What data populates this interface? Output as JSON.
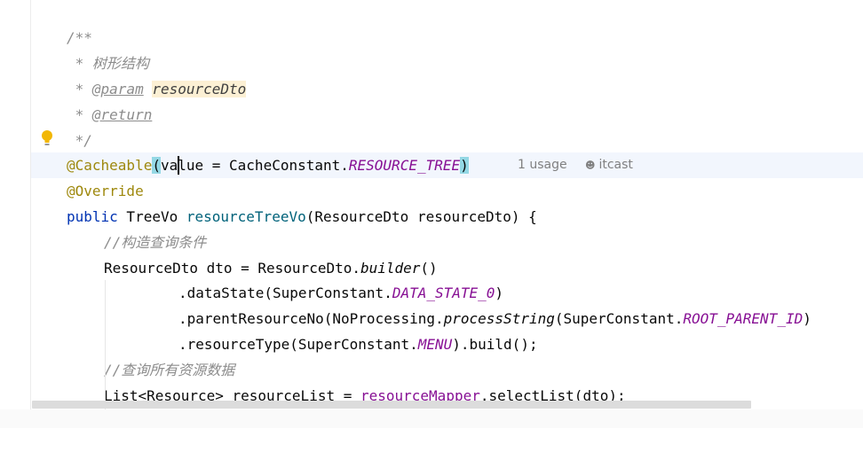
{
  "editor": {
    "lines": {
      "l1": "/**",
      "l2_star": " * ",
      "l2_text": "树形结构",
      "l3_star": " * ",
      "l3_tag": "@param",
      "l3_sp": " ",
      "l3_param": "resourceDto",
      "l4_star": " * ",
      "l4_tag": "@return",
      "l5": " */",
      "l6_annot": "@Cacheable",
      "l6_open": "(",
      "l6_value": "value = CacheConstant.",
      "l6_const": "RESOURCE_TREE",
      "l6_close": ")",
      "l7_annot": "@Override",
      "l8_kw": "public",
      "l8_type": " TreeVo ",
      "l8_method": "resourceTreeVo",
      "l8_rest": "(ResourceDto resourceDto) {",
      "l9_comment": "//构造查询条件",
      "l10_a": "ResourceDto dto = ResourceDto.",
      "l10_b": "builder",
      "l10_c": "()",
      "l11_a": ".dataState(SuperConstant.",
      "l11_b": "DATA_STATE_0",
      "l11_c": ")",
      "l12_a": ".parentResourceNo(NoProcessing.",
      "l12_b": "processString",
      "l12_c": "(SuperConstant.",
      "l12_d": "ROOT_PARENT_ID",
      "l12_e": ")",
      "l13_a": ".resourceType(SuperConstant.",
      "l13_b": "MENU",
      "l13_c": ").build();",
      "l14_comment": "//查询所有资源数据",
      "l15_a": "List<Resource> resourceList = ",
      "l15_b": "resourceMapper",
      "l15_c": ".selectList(dto);"
    },
    "inlay": {
      "usages": "1 usage",
      "author": "itcast"
    }
  },
  "icons": {
    "bulb": "lightbulb-icon",
    "author": "user-icon"
  },
  "colors": {
    "comment": "#8c8c8c",
    "annotation": "#9e880d",
    "keyword": "#0033b3",
    "method": "#00627a",
    "constant": "#871094",
    "current_line": "#f2f6fd",
    "paren_match": "#94d8e5",
    "param_highlight": "#fcf0d4"
  }
}
